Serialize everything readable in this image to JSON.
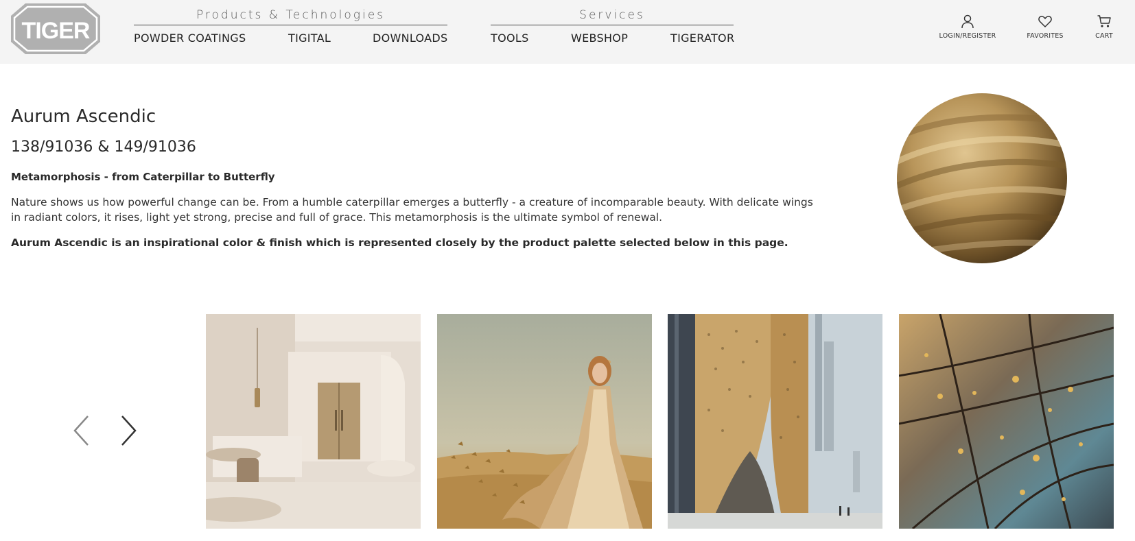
{
  "header": {
    "logo_text": "TIGER",
    "groups": {
      "products": "Products & Technologies",
      "services": "Services"
    },
    "nav": {
      "powder_coatings": "POWDER COATINGS",
      "tigital": "TIGITAL",
      "downloads": "DOWNLOADS",
      "tools": "TOOLS",
      "webshop": "WEBSHOP",
      "tigerator": "TIGERATOR"
    },
    "utility": {
      "login": "LOGIN/REGISTER",
      "favorites": "FAVORITES",
      "cart": "CART"
    }
  },
  "intro": {
    "title": "Aurum Ascendic",
    "codes": "138/91036 & 149/91036",
    "subheading": "Metamorphosis - from Caterpillar to Butterfly",
    "body": "Nature shows us how powerful change can be. From a humble caterpillar emerges a butterfly - a creature of incomparable beauty. With delicate wings in radiant colors, it rises, light yet strong, precise and full of grace. This metamorphosis is the ultimate symbol of renewal.",
    "statement": "Aurum Ascendic is an inspirational color & finish which is represented closely by the product palette selected below in this page."
  },
  "icons": {
    "prev": "chevron-left-icon",
    "next": "chevron-right-icon",
    "user": "user-icon",
    "heart": "heart-icon",
    "cart": "cart-icon"
  },
  "colors": {
    "header_bg": "#f4f4f4",
    "gold": "#b8955a",
    "gold_dark": "#7a5e30",
    "text": "#222222"
  }
}
